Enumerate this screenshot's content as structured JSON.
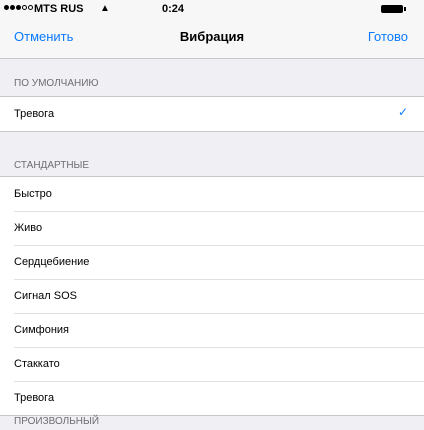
{
  "status_bar": {
    "carrier": "MTS RUS",
    "time": "0:24"
  },
  "nav": {
    "cancel_label": "Отменить",
    "title": "Вибрация",
    "done_label": "Готово"
  },
  "default_section": {
    "header": "ПО УМОЛЧАНИЮ",
    "item": "Тревога"
  },
  "standard_section": {
    "header": "СТАНДАРТНЫЕ",
    "items": [
      "Быстро",
      "Живо",
      "Сердцебиение",
      "Сигнал SOS",
      "Симфония",
      "Стаккато",
      "Тревога"
    ]
  },
  "custom_section": {
    "header": "ПРОИЗВОЛЬНЫЙ"
  },
  "colors": {
    "accent": "#0a7aff",
    "background": "#efeff4"
  }
}
